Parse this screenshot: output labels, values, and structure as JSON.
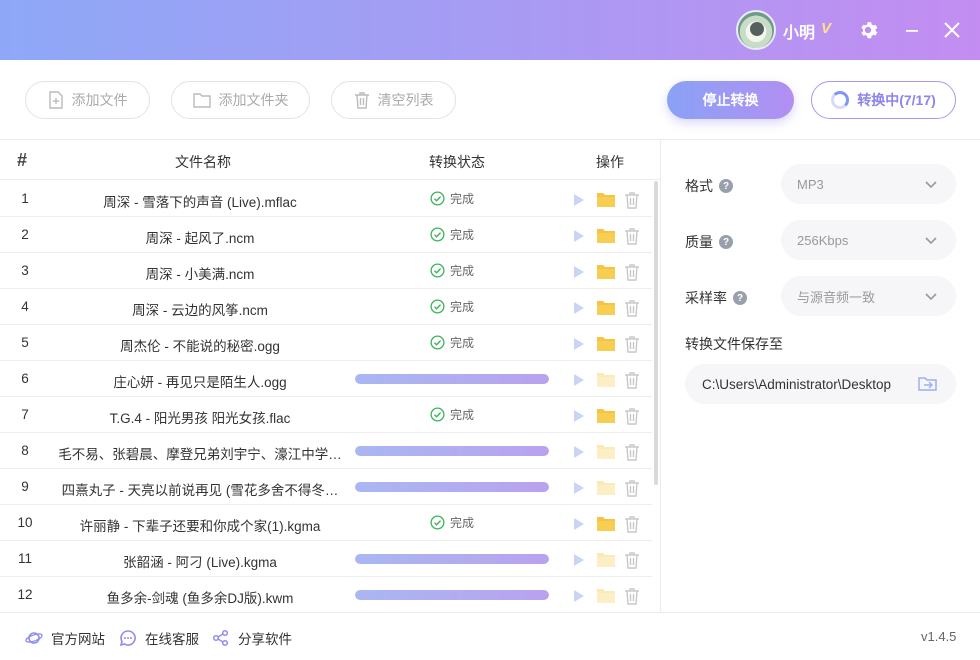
{
  "user": {
    "name": "小明",
    "vip_badge": "V"
  },
  "window_controls": {
    "settings_icon": "gear-icon",
    "minimize_icon": "minimize-icon",
    "close_icon": "close-icon"
  },
  "toolbar": {
    "add_file": "添加文件",
    "add_folder": "添加文件夹",
    "clear_list": "清空列表",
    "stop": "停止转换",
    "progress": "转换中(7/17)"
  },
  "table": {
    "headers": {
      "index": "#",
      "name": "文件名称",
      "status": "转换状态",
      "actions": "操作"
    },
    "rows": [
      {
        "num": "1",
        "name": "周深 - 雪落下的声音 (Live).mflac",
        "state": "done",
        "status": "完成"
      },
      {
        "num": "2",
        "name": "周深 - 起风了.ncm",
        "state": "done",
        "status": "完成"
      },
      {
        "num": "3",
        "name": "周深 - 小美满.ncm",
        "state": "done",
        "status": "完成"
      },
      {
        "num": "4",
        "name": "周深 - 云边的风筝.ncm",
        "state": "done",
        "status": "完成"
      },
      {
        "num": "5",
        "name": "周杰伦 - 不能说的秘密.ogg",
        "state": "done",
        "status": "完成"
      },
      {
        "num": "6",
        "name": "庄心妍 - 再见只是陌生人.ogg",
        "state": "converting",
        "status": ""
      },
      {
        "num": "7",
        "name": "T.G.4 - 阳光男孩 阳光女孩.flac",
        "state": "done",
        "status": "完成"
      },
      {
        "num": "8",
        "name": "毛不易、张碧晨、摩登兄弟刘宇宁、濠江中学…",
        "state": "converting",
        "status": ""
      },
      {
        "num": "9",
        "name": "四熹丸子 - 天亮以前说再见 (雪花多舍不得冬…",
        "state": "converting",
        "status": ""
      },
      {
        "num": "10",
        "name": "许丽静 - 下辈子还要和你成个家(1).kgma",
        "state": "done",
        "status": "完成"
      },
      {
        "num": "11",
        "name": "张韶涵 - 阿刁 (Live).kgma",
        "state": "converting",
        "status": ""
      },
      {
        "num": "12",
        "name": "鱼多余-剑魂 (鱼多余DJ版).kwm",
        "state": "converting",
        "status": ""
      }
    ]
  },
  "settings": {
    "format": {
      "label": "格式",
      "value": "MP3"
    },
    "quality": {
      "label": "质量",
      "value": "256Kbps"
    },
    "sample_rate": {
      "label": "采样率",
      "value": "与源音频一致"
    },
    "save_to": {
      "label": "转换文件保存至",
      "value": "C:\\Users\\Administrator\\Desktop"
    }
  },
  "footer": {
    "website": "官方网站",
    "support": "在线客服",
    "share": "分享软件",
    "version": "v1.4.5"
  },
  "colors": {
    "accent_start": "#8ea8f7",
    "accent_end": "#c38df2",
    "done_green": "#3cb55a",
    "folder_yellow": "#f6c343"
  }
}
